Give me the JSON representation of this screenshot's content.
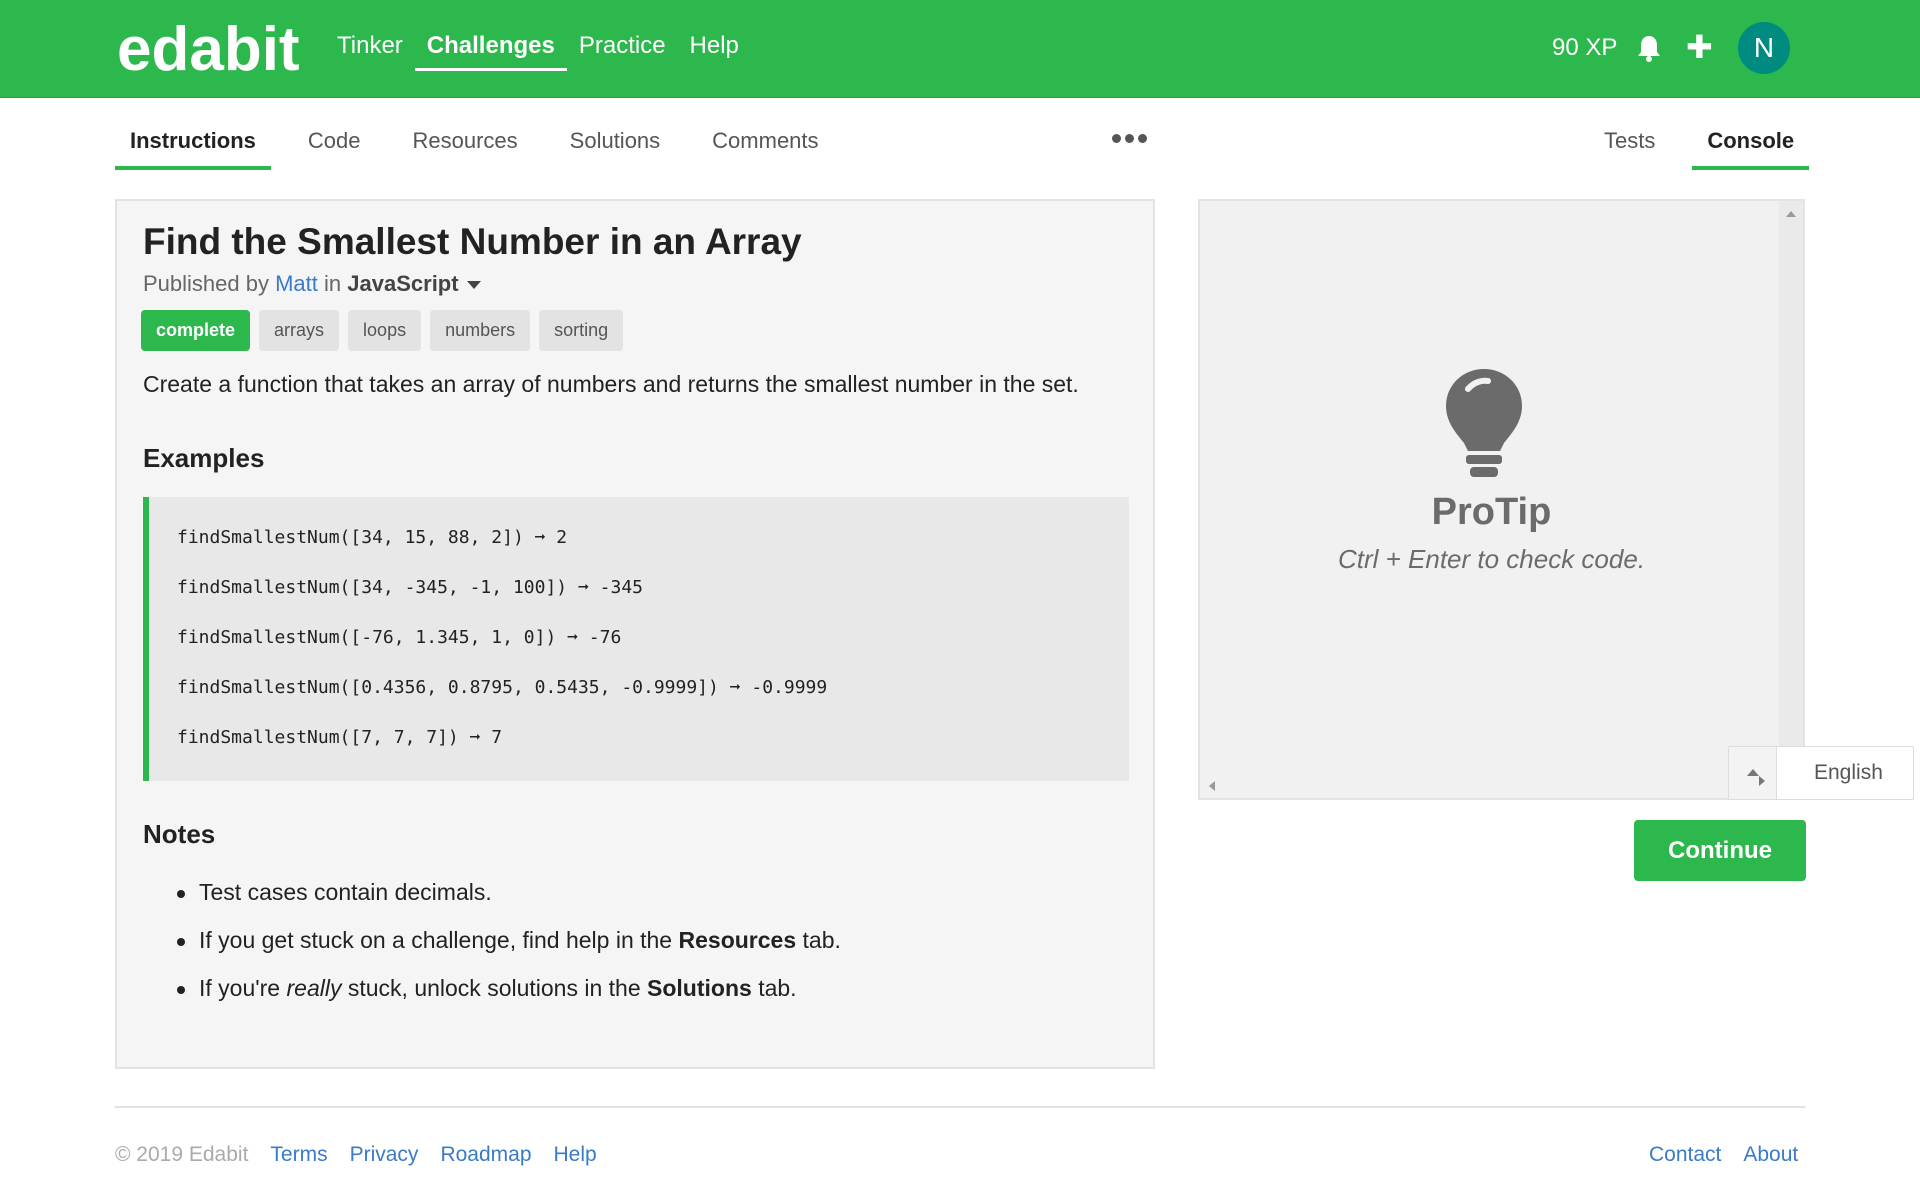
{
  "header": {
    "logo": "edabit",
    "nav": [
      {
        "label": "Tinker"
      },
      {
        "label": "Challenges",
        "active": true
      },
      {
        "label": "Practice"
      },
      {
        "label": "Help"
      }
    ],
    "xp": "90 XP",
    "bell_icon": "bell-icon",
    "plus_label": "✚",
    "avatar_initial": "N",
    "colors": {
      "bar": "#2db84d",
      "avatar": "#008b80"
    }
  },
  "tabs": {
    "left": [
      {
        "label": "Instructions",
        "active": true
      },
      {
        "label": "Code"
      },
      {
        "label": "Resources"
      },
      {
        "label": "Solutions"
      },
      {
        "label": "Comments"
      }
    ],
    "more_icon": "more-dots-icon",
    "right": [
      {
        "label": "Tests"
      },
      {
        "label": "Console",
        "active": true
      }
    ]
  },
  "challenge": {
    "title": "Find the Smallest Number in an Array",
    "published_prefix": "Published by",
    "author": "Matt",
    "in_word": "in",
    "language": "JavaScript",
    "tags": [
      "complete",
      "arrays",
      "loops",
      "numbers",
      "sorting"
    ],
    "description": "Create a function that takes an array of numbers and returns the smallest number in the set.",
    "examples_heading": "Examples",
    "examples": [
      "findSmallestNum([34, 15, 88, 2]) ➞ 2",
      "findSmallestNum([34, -345, -1, 100]) ➞ -345",
      "findSmallestNum([-76, 1.345, 1, 0]) ➞ -76",
      "findSmallestNum([0.4356, 0.8795, 0.5435, -0.9999]) ➞ -0.9999",
      "findSmallestNum([7, 7, 7]) ➞ 7"
    ],
    "notes_heading": "Notes",
    "notes": {
      "n1": "Test cases contain decimals.",
      "n2_pre": "If you get stuck on a challenge, find help in the",
      "n2_bold": "Resources",
      "n2_post": "tab.",
      "n3_pre": "If you're",
      "n3_em": "really",
      "n3_mid": "stuck, unlock solutions in the",
      "n3_bold": "Solutions",
      "n3_post": "tab."
    }
  },
  "console": {
    "icon": "lightbulb-icon",
    "protip_title": "ProTip",
    "protip_text": "Ctrl + Enter to check code."
  },
  "language_select": {
    "value": "English"
  },
  "continue_label": "Continue",
  "footer": {
    "copyright": "© 2019 Edabit",
    "left_links": [
      "Terms",
      "Privacy",
      "Roadmap",
      "Help"
    ],
    "right_links": [
      "Contact",
      "About"
    ]
  }
}
